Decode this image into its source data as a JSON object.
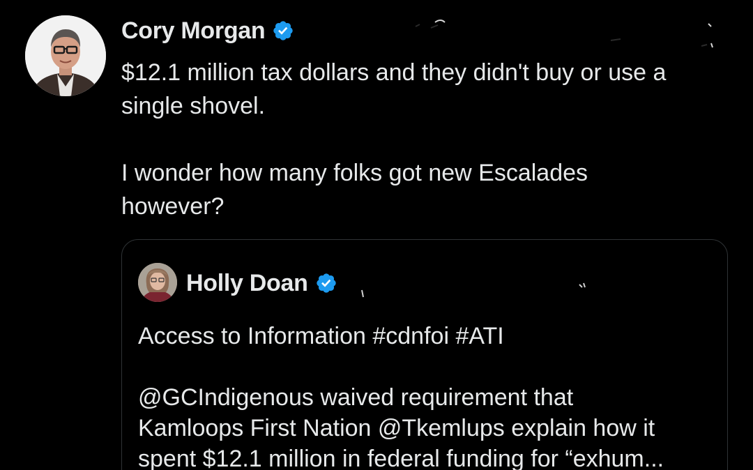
{
  "tweet": {
    "author": {
      "name": "Cory Morgan",
      "avatar_icon": "person-headshot-avatar",
      "verified_icon": "verified-badge-icon"
    },
    "text_lines": [
      "$12.1 million tax dollars and they didn't buy or use a",
      "single shovel.",
      "",
      "I wonder how many folks got new Escalades",
      "however?"
    ]
  },
  "quote": {
    "author": {
      "name": "Holly Doan",
      "avatar_icon": "person-headshot-avatar",
      "verified_icon": "verified-badge-icon"
    },
    "text_lines": [
      "Access to Information #cdnfoi #ATI",
      "",
      "@GCIndigenous waived requirement that",
      "Kamloops First Nation @Tkemlups  explain how it",
      "spent $12.1 million in federal funding for “exhum..."
    ]
  },
  "colors": {
    "background": "#000000",
    "text": "#e7e9ea",
    "verified": "#1d9bf0",
    "card_border": "#2f3336"
  }
}
